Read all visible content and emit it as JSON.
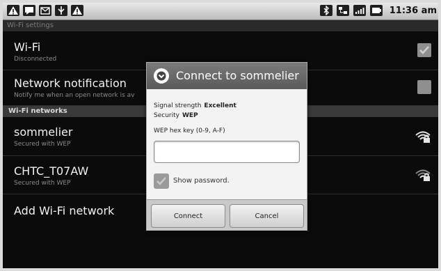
{
  "status_bar": {
    "left_icons": [
      "warning-icon",
      "chat-icon",
      "mail-icon",
      "usb-icon",
      "warning-icon"
    ],
    "right_icons": [
      "bluetooth-icon",
      "network-icon",
      "signal-icon",
      "battery-icon"
    ],
    "time": "11:36 am"
  },
  "screen": {
    "title": "Wi-Fi settings"
  },
  "settings": {
    "wifi": {
      "title": "Wi-Fi",
      "summary": "Disconnected",
      "checked": true
    },
    "notification": {
      "title": "Network notification",
      "summary": "Notify me when an open network is av",
      "checked": false
    }
  },
  "networks_header": "Wi-Fi networks",
  "networks": [
    {
      "name": "sommelier",
      "security": "Secured with WEP",
      "icon": "wifi-locked-icon"
    },
    {
      "name": "CHTC_T07AW",
      "security": "Secured with WEP",
      "icon": "wifi-locked-icon"
    }
  ],
  "add_network": "Add Wi-Fi network",
  "dialog": {
    "title": "Connect to sommelier",
    "signal_label": "Signal strength",
    "signal_value": "Excellent",
    "security_label": "Security",
    "security_value": "WEP",
    "key_label": "WEP hex key (0-9, A-F)",
    "key_value": "",
    "show_password": "Show password.",
    "show_password_checked": true,
    "connect": "Connect",
    "cancel": "Cancel"
  }
}
